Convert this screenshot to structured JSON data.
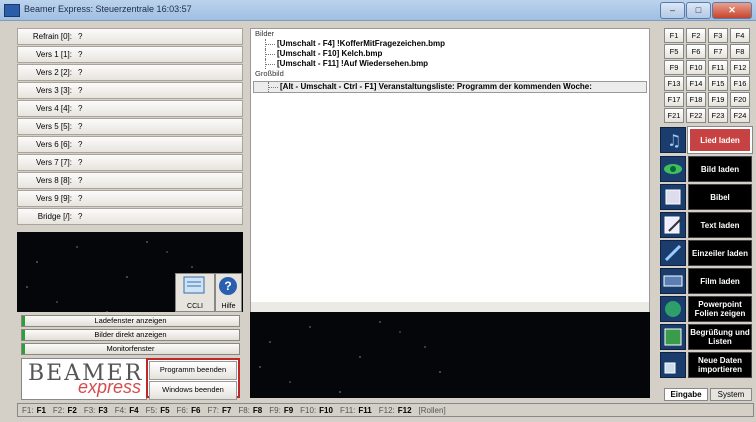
{
  "window": {
    "title": "Beamer Express: Steuerzentrale  16:03:57"
  },
  "verses": [
    {
      "label": "Refrain [0]:",
      "value": "?"
    },
    {
      "label": "Vers 1 [1]:",
      "value": "?"
    },
    {
      "label": "Vers 2 [2]:",
      "value": "?"
    },
    {
      "label": "Vers 3 [3]:",
      "value": "?"
    },
    {
      "label": "Vers 4 [4]:",
      "value": "?"
    },
    {
      "label": "Vers 5 [5]:",
      "value": "?"
    },
    {
      "label": "Vers 6 [6]:",
      "value": "?"
    },
    {
      "label": "Vers 7 [7]:",
      "value": "?"
    },
    {
      "label": "Vers 8 [8]:",
      "value": "?"
    },
    {
      "label": "Vers 9 [9]:",
      "value": "?"
    },
    {
      "label": "Bridge [/]:",
      "value": "?"
    }
  ],
  "icons": {
    "ccli_label": "CCLI",
    "help_label": "Hilfe"
  },
  "left_buttons": {
    "ladefenster": "Ladefenster anzeigen",
    "bilder_direkt": "Bilder direkt anzeigen",
    "monitorfenster": "Monitorfenster"
  },
  "logo": {
    "line1": "BEAMER",
    "line2": "express"
  },
  "exit_buttons": {
    "programm": "Programm beenden",
    "windows": "Windows beenden"
  },
  "center": {
    "section_bilder": "Bilder",
    "bilder": [
      "[Umschalt - F4]  !KofferMitFragezeichen.bmp",
      "[Umschalt - F10]  Kelch.bmp",
      "[Umschalt - F11]  !Auf Wiedersehen.bmp"
    ],
    "section_grossbild": "Großbild",
    "grossbild": "[Alt - Umschalt - Ctrl - F1]  Veranstaltungsliste: Programm der kommenden Woche:"
  },
  "fkeys": [
    "F1",
    "F2",
    "F3",
    "F4",
    "F5",
    "F6",
    "F7",
    "F8",
    "F9",
    "F10",
    "F11",
    "F12",
    "F13",
    "F14",
    "F15",
    "F16",
    "F17",
    "F18",
    "F19",
    "F20",
    "F21",
    "F22",
    "F23",
    "F24"
  ],
  "tools": [
    {
      "label": "Lied laden",
      "icon": "music-note-icon"
    },
    {
      "label": "Bild laden",
      "icon": "eye-icon"
    },
    {
      "label": "Bibel",
      "icon": "book-icon"
    },
    {
      "label": "Text laden",
      "icon": "text-edit-icon"
    },
    {
      "label": "Einzeiler laden",
      "icon": "pen-icon"
    },
    {
      "label": "Film laden",
      "icon": "film-icon"
    },
    {
      "label": "Powerpoint Folien zeigen",
      "icon": "globe-icon"
    },
    {
      "label": "Begrüßung und Listen",
      "icon": "image-icon"
    },
    {
      "label": "Neue Daten importieren",
      "icon": "import-icon"
    }
  ],
  "tabs": {
    "eingabe": "Eingabe",
    "system": "System"
  },
  "statusbar": [
    {
      "key": "F1:",
      "val": "F1"
    },
    {
      "key": "F2:",
      "val": "F2"
    },
    {
      "key": "F3:",
      "val": "F3"
    },
    {
      "key": "F4:",
      "val": "F4"
    },
    {
      "key": "F5:",
      "val": "F5"
    },
    {
      "key": "F6:",
      "val": "F6"
    },
    {
      "key": "F7:",
      "val": "F7"
    },
    {
      "key": "F8:",
      "val": "F8"
    },
    {
      "key": "F9:",
      "val": "F9"
    },
    {
      "key": "F10:",
      "val": "F10"
    },
    {
      "key": "F11:",
      "val": "F11"
    },
    {
      "key": "F12:",
      "val": "F12"
    }
  ],
  "statusbar_extra": "[Rollen]",
  "colors": {
    "accent_red": "#c74343",
    "green_bar": "#2e9e3a",
    "tool_dark": "#000000"
  }
}
